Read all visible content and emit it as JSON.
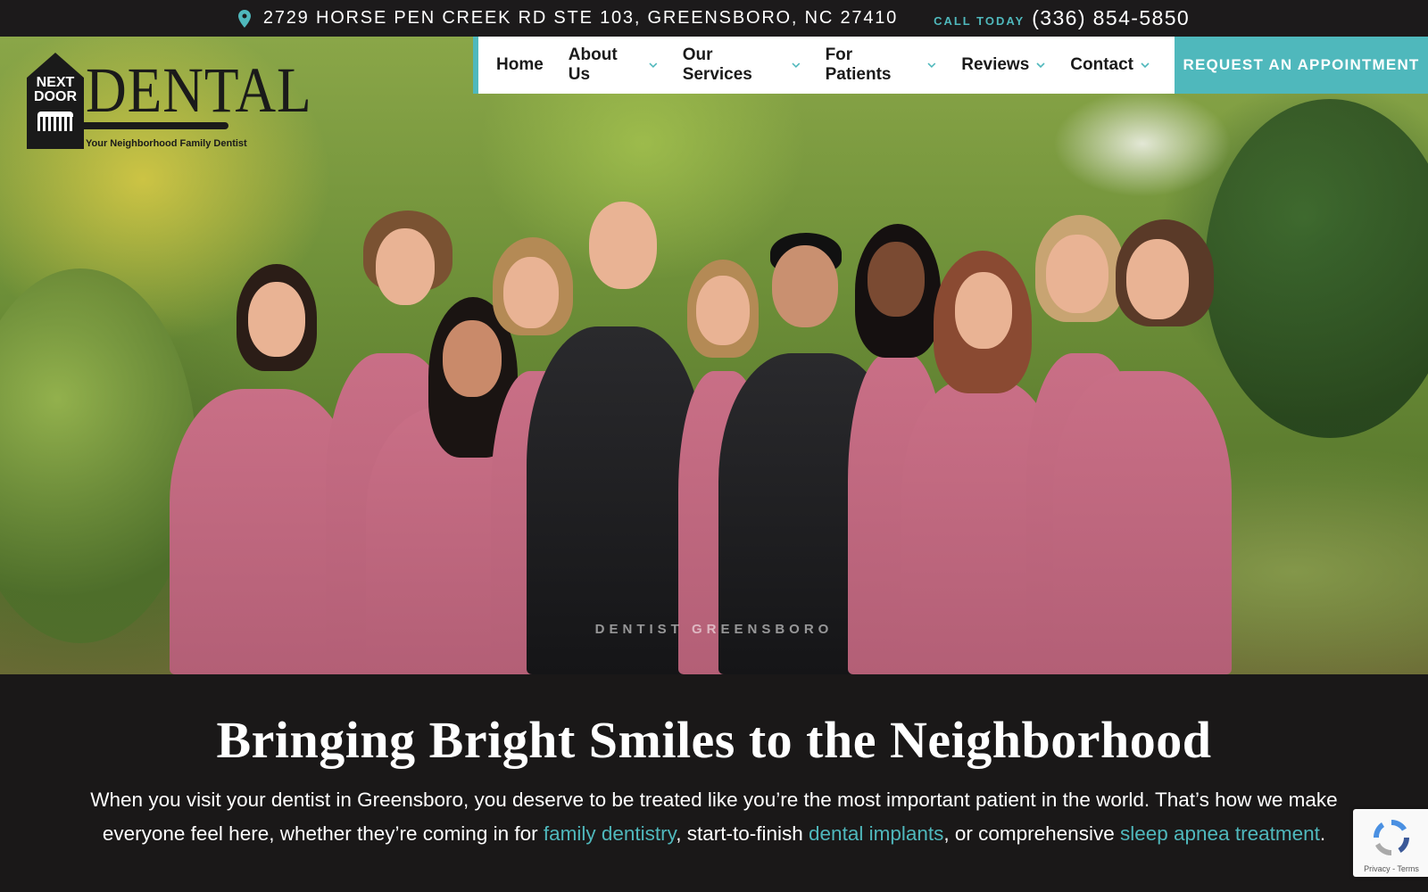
{
  "topbar": {
    "address": "2729 HORSE PEN CREEK RD STE 103, GREENSBORO, NC 27410",
    "call_label": "CALL TODAY",
    "phone": "(336) 854-5850",
    "pin_icon": "map-pin-icon"
  },
  "logo": {
    "line1": "NEXT",
    "line2": "DOOR",
    "wordmark": "DENTAL",
    "tagline": "Your Neighborhood Family Dentist"
  },
  "nav": {
    "items": [
      {
        "label": "Home",
        "has_dropdown": false
      },
      {
        "label": "About Us",
        "has_dropdown": true
      },
      {
        "label": "Our Services",
        "has_dropdown": true
      },
      {
        "label": "For Patients",
        "has_dropdown": true
      },
      {
        "label": "Reviews",
        "has_dropdown": true
      },
      {
        "label": "Contact",
        "has_dropdown": true
      }
    ],
    "cta": "REQUEST AN APPOINTMENT"
  },
  "hero": {
    "caption": "DENTIST GREENSBORO"
  },
  "content": {
    "headline": "Bringing Bright Smiles to the Neighborhood",
    "para_1": "When you visit your dentist in Greensboro, you deserve to be treated like you’re the most important patient in the world. That’s how we make everyone feel here, whether they’re coming in for ",
    "link_1": "family dentistry",
    "para_2": ", start-to-finish ",
    "link_2": "dental implants",
    "para_3": ", or comprehensive ",
    "link_3": "sleep apnea treatment",
    "para_4": "."
  },
  "recaptcha": {
    "terms": "Privacy - Terms"
  },
  "colors": {
    "accent": "#4fb8bc",
    "dark": "#1a1818",
    "scrub_pink": "#c96f86"
  }
}
